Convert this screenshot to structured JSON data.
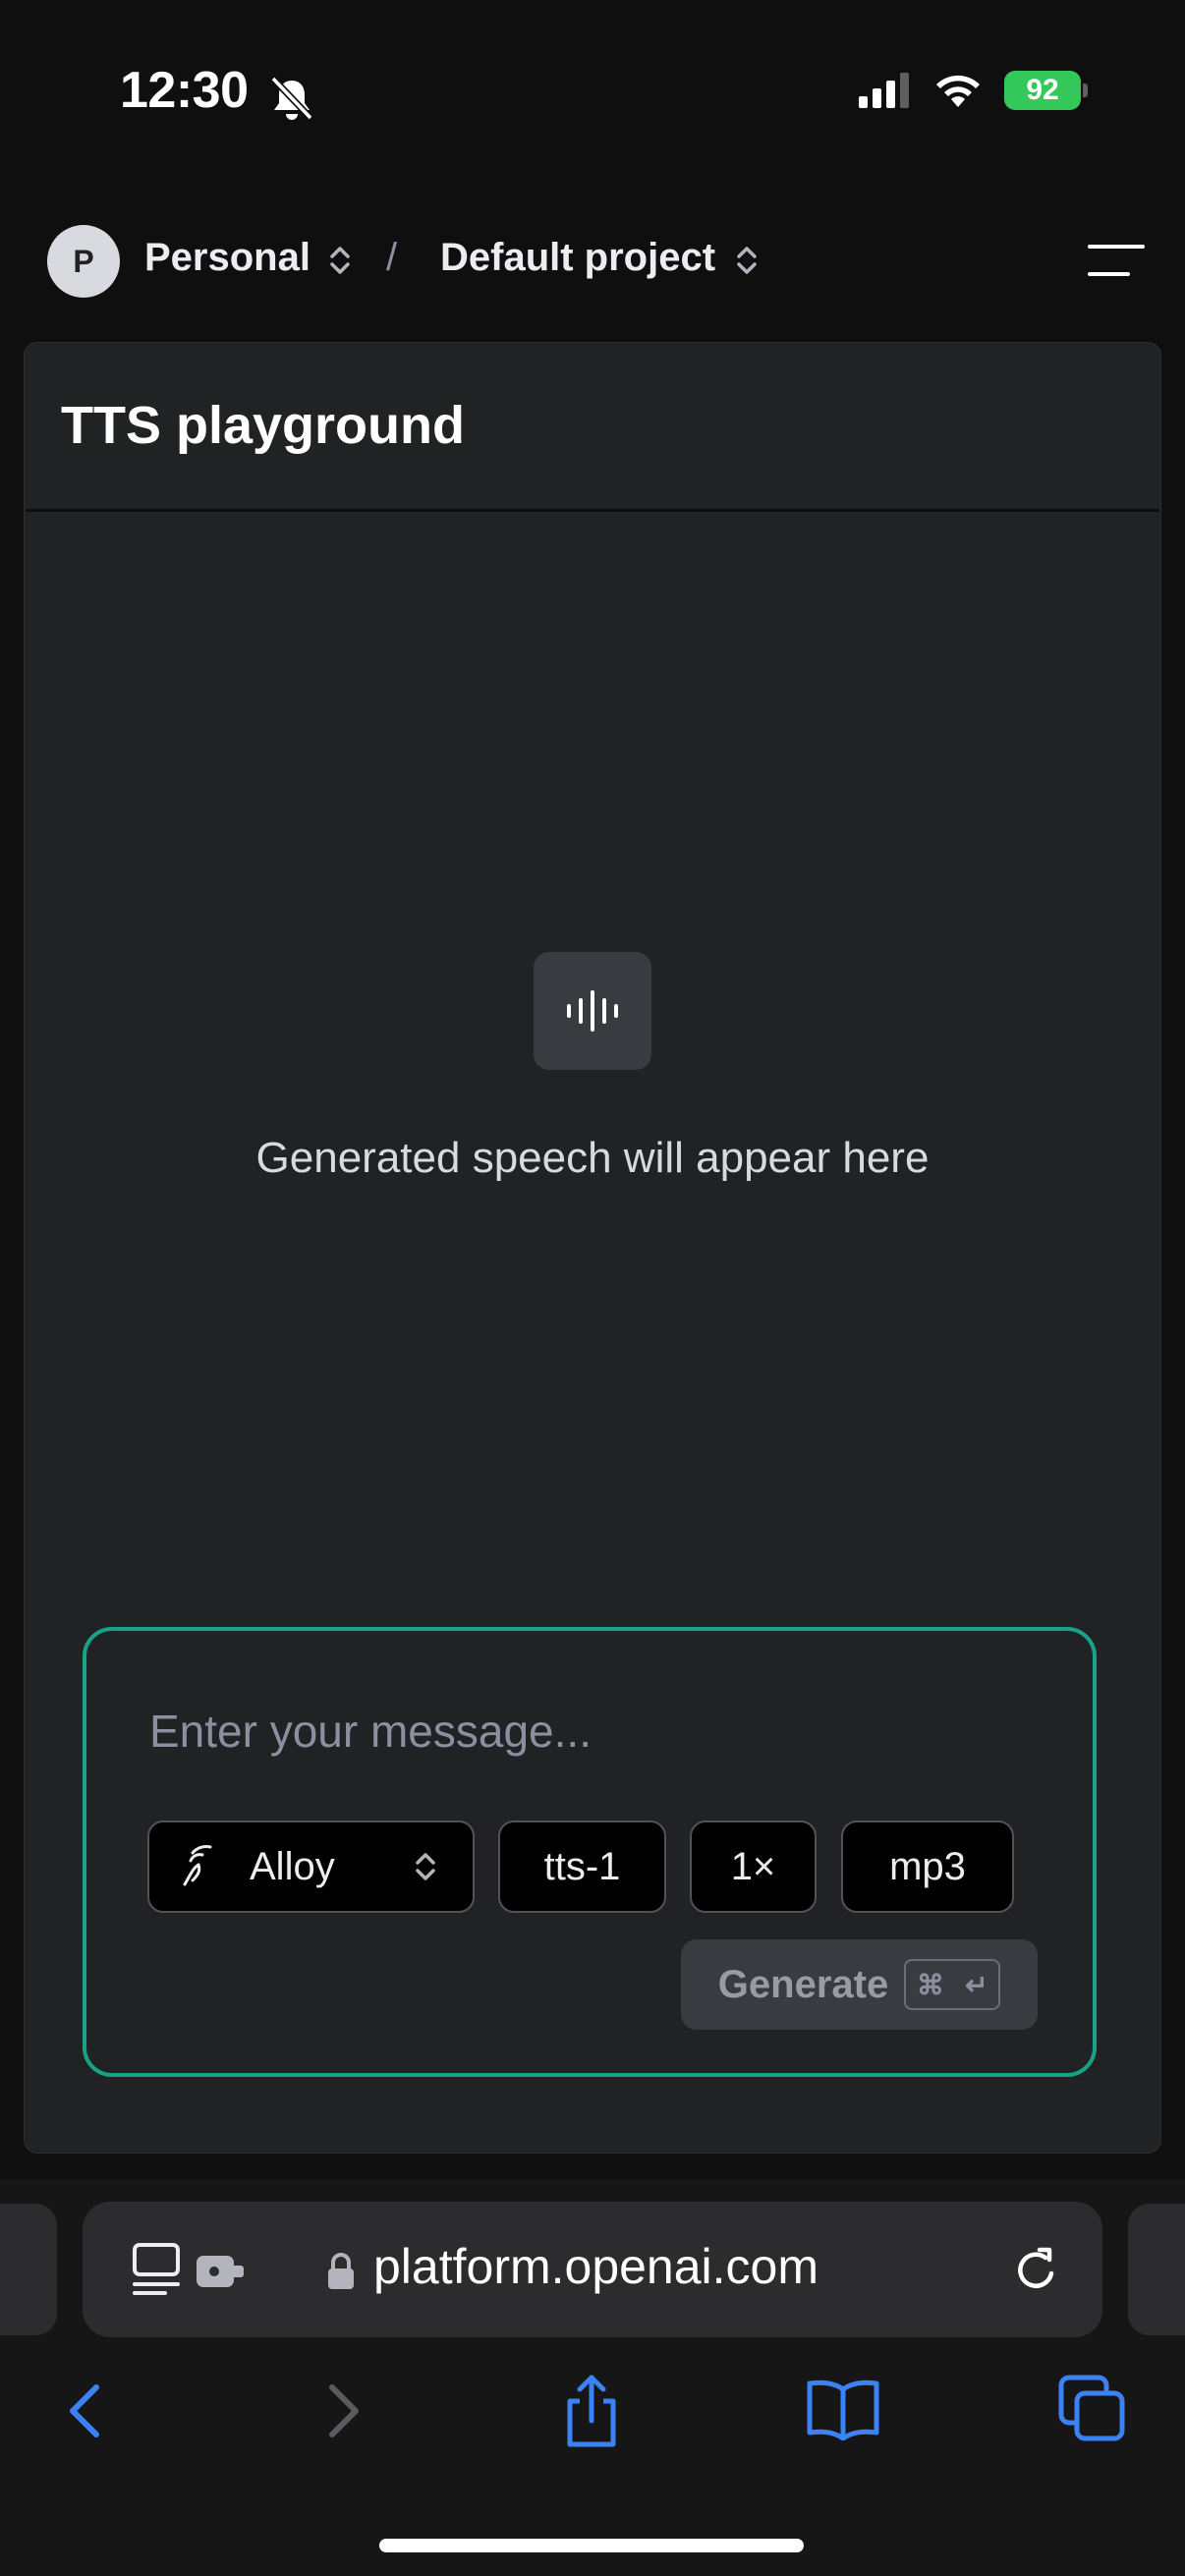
{
  "status_bar": {
    "time": "12:30",
    "battery": "92",
    "icons": [
      "bell-slash-icon",
      "signal-icon",
      "wifi-icon",
      "battery-icon"
    ]
  },
  "header": {
    "avatar_initial": "P",
    "org": "Personal",
    "separator": "/",
    "project": "Default project"
  },
  "panel": {
    "title": "TTS playground",
    "empty_state": "Generated speech will appear here"
  },
  "composer": {
    "placeholder": "Enter your message...",
    "voice": "Alloy",
    "model": "tts-1",
    "speed": "1×",
    "format": "mp3",
    "generate_label": "Generate",
    "shortcut_cmd": "⌘",
    "shortcut_enter": "↵"
  },
  "browser": {
    "url": "platform.openai.com"
  },
  "colors": {
    "accent": "#19a386",
    "ios_blue": "#3b82f6",
    "battery_green": "#34c759"
  }
}
